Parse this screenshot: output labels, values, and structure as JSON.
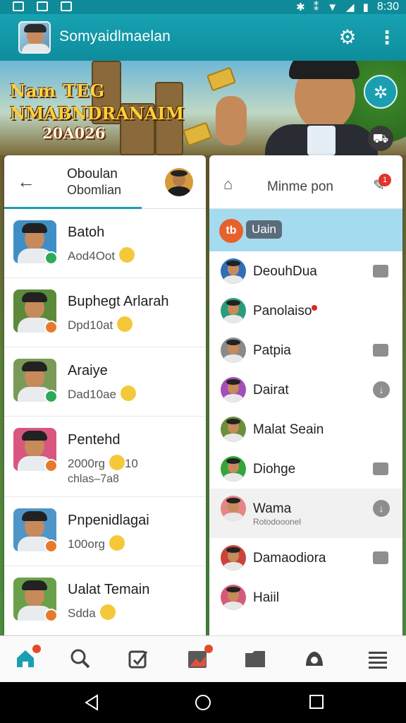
{
  "status_bar": {
    "time": "8:30",
    "left_icons": [
      "notification-icon",
      "image-icon",
      "message-icon"
    ],
    "right_icons": [
      "bluetooth-icon",
      "vibrate-icon",
      "wifi-icon",
      "signal-icon",
      "battery-icon"
    ]
  },
  "app_bar": {
    "title": "Somyaidlmaelan",
    "icons": [
      "settings-icon",
      "more-vert-icon"
    ]
  },
  "banner": {
    "logo_line1": "Nam TEG",
    "logo_line2": "NMABNDRANAIM",
    "logo_line3": "20A026"
  },
  "left_panel": {
    "header_title": "Oboulan",
    "header_subtitle": "Obomlian",
    "contacts": [
      {
        "name": "Batoh",
        "sub": "Aod4Oot",
        "badge_color": "#2eaa57",
        "av_bg": "#3f8fc7"
      },
      {
        "name": "Buphegt Arlarah",
        "sub": "Dpd10at",
        "badge_color": "#e77a2a",
        "av_bg": "#5b8a3a"
      },
      {
        "name": "Araiye",
        "sub": "Dad10ae",
        "badge_color": "#2eaa57",
        "av_bg": "#7b9a58"
      },
      {
        "name": "Pentehd",
        "sub": "2000rg",
        "sub_extra": "10",
        "sub2": "chlas–7a8",
        "badge_color": "#e77a2a",
        "av_bg": "#d9567f"
      },
      {
        "name": "Pnpenidlagai",
        "sub": "100org",
        "badge_color": "#e77a2a",
        "av_bg": "#4f95c8"
      },
      {
        "name": "Ualat Temain",
        "sub": "Sdda",
        "badge_color": "#e77a2a",
        "av_bg": "#6aa04a"
      }
    ]
  },
  "right_panel": {
    "header_title": "Minme pon",
    "notif_count": "1",
    "selected_chip": "Uain",
    "selected_icon": "tb",
    "items": [
      {
        "name": "DeouhDua",
        "action": "folder",
        "av_bg": "#2f6fb8"
      },
      {
        "name": "Panolaiso",
        "action": "",
        "has_dot": true,
        "av_bg": "#2a9c7e"
      },
      {
        "name": "Patpia",
        "action": "folder",
        "av_bg": "#8a8a8a"
      },
      {
        "name": "Dairat",
        "action": "download",
        "av_bg": "#a24fb7"
      },
      {
        "name": "Malat Seain",
        "action": "",
        "av_bg": "#6c8f3c"
      },
      {
        "name": "Diohge",
        "action": "folder",
        "av_bg": "#34a53b"
      },
      {
        "name": "Wama",
        "sub": "Rotodooonel",
        "action": "download",
        "av_bg": "#e58585"
      },
      {
        "name": "Damaodiora",
        "action": "folder",
        "av_bg": "#c9443a"
      },
      {
        "name": "Haiil",
        "action": "",
        "av_bg": "#d55b7a"
      }
    ]
  },
  "bottom_nav": {
    "items": [
      "home-icon",
      "search-icon",
      "edit-icon",
      "image-icon",
      "folder-icon",
      "camera-icon",
      "menu-icon"
    ],
    "active": "home-icon",
    "accent": "#1b9fb0"
  },
  "android_nav": [
    "back-icon",
    "home-circle-icon",
    "recents-icon"
  ]
}
